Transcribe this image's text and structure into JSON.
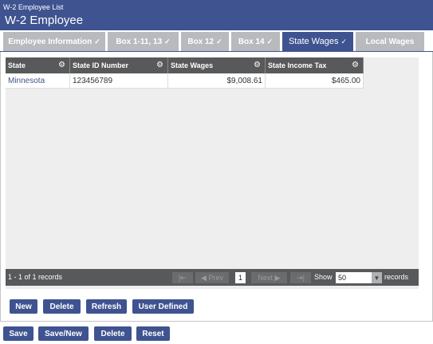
{
  "header": {
    "breadcrumb": "W-2 Employee List",
    "title": "W-2 Employee"
  },
  "tabs": [
    {
      "label": "Employee Information",
      "check": "✓"
    },
    {
      "label": "Box 1-11, 13",
      "check": "✓"
    },
    {
      "label": "Box 12",
      "check": "✓"
    },
    {
      "label": "Box 14",
      "check": "✓"
    },
    {
      "label": "State Wages",
      "check": "✓"
    },
    {
      "label": "Local Wages",
      "check": ""
    }
  ],
  "grid": {
    "columns": [
      "State",
      "State ID Number",
      "State Wages",
      "State Income Tax"
    ],
    "rows": [
      {
        "state": "Minnesota",
        "state_id": "123456789",
        "wages": "$9,008.61",
        "tax": "$465.00"
      }
    ]
  },
  "pager": {
    "count": "1 - 1 of 1 records",
    "first": "|⇤",
    "prev": "◀ Prev",
    "page": "1",
    "next": "Next ▶",
    "last": "⇥|",
    "show_label": "Show",
    "page_size": "50",
    "records_label": "records"
  },
  "grid_buttons": {
    "new": "New",
    "delete": "Delete",
    "refresh": "Refresh",
    "user_defined": "User Defined"
  },
  "form_buttons": {
    "save": "Save",
    "save_new": "Save/New",
    "delete": "Delete",
    "reset": "Reset"
  }
}
